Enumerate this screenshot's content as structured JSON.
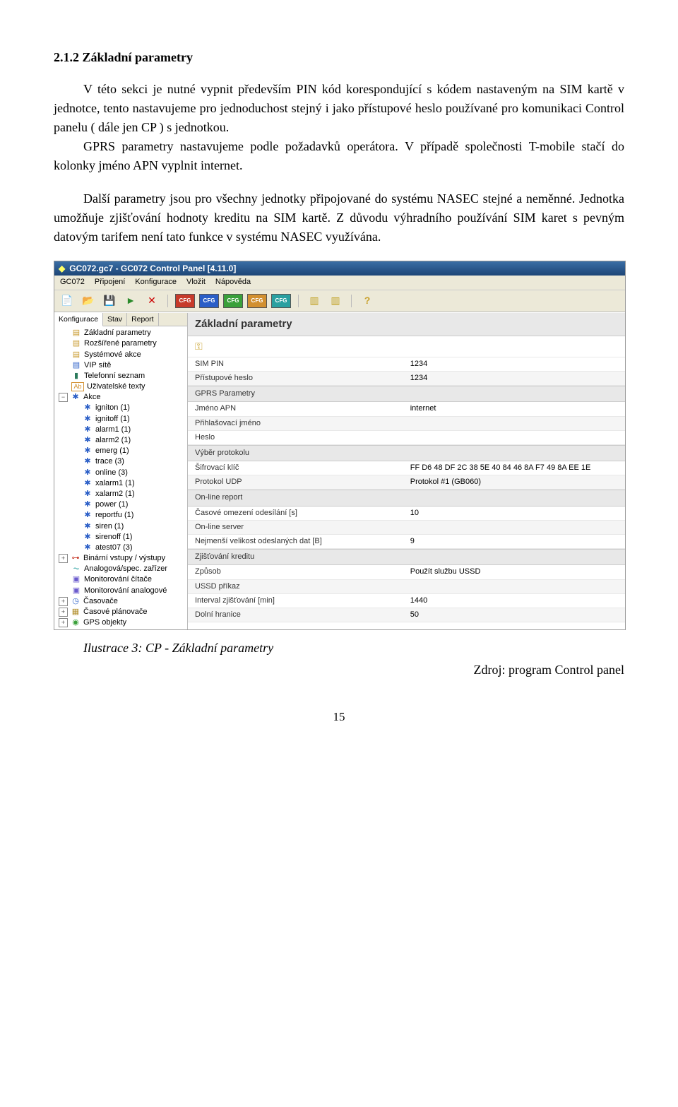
{
  "heading": "2.1.2  Základní parametry",
  "para1": "V této sekci je nutné vypnit především PIN kód korespondující s kódem nastaveným na SIM kartě v jednotce, tento nastavujeme pro jednoduchost stejný i jako přístupové heslo používané pro komunikaci Control panelu ( dále jen CP ) s jednotkou.",
  "para2": "GPRS parametry nastavujeme podle požadavků operátora. V případě společnosti T-mobile stačí do kolonky jméno APN vyplnit internet.",
  "para3": "Další parametry jsou pro všechny jednotky připojované do systému NASEC stejné a neměnné. Jednotka umožňuje zjišťování hodnoty kreditu na SIM kartě. Z důvodu výhradního používání SIM karet s pevným datovým tarifem není tato funkce v systému NASEC využívána.",
  "window": {
    "title": "GC072.gc7 - GC072 Control Panel [4.11.0]",
    "menu": [
      "GC072",
      "Připojení",
      "Konfigurace",
      "Vložit",
      "Nápověda"
    ],
    "cfg_labels": [
      "CFG",
      "CFG",
      "CFG",
      "CFG",
      "CFG"
    ],
    "side_tabs": [
      "Konfigurace",
      "Stav",
      "Report"
    ],
    "tree_top": [
      {
        "label": "Základní parametry"
      },
      {
        "label": "Rozšířené parametry"
      },
      {
        "label": "Systémové akce"
      },
      {
        "label": "VIP sítě"
      },
      {
        "label": "Telefonní seznam"
      },
      {
        "label": "Uživatelské texty"
      }
    ],
    "tree_akce_label": "Akce",
    "tree_akce": [
      "igniton (1)",
      "ignitoff (1)",
      "alarm1 (1)",
      "alarm2 (1)",
      "emerg (1)",
      "trace (3)",
      "online (3)",
      "xalarm1 (1)",
      "xalarm2 (1)",
      "power (1)",
      "reportfu (1)",
      "siren (1)",
      "sirenoff (1)",
      "atest07 (3)"
    ],
    "tree_bottom": [
      {
        "label": "Binární vstupy / výstupy"
      },
      {
        "label": "Analogová/spec. zařízer"
      },
      {
        "label": "Monitorování čítače"
      },
      {
        "label": "Monitorování analogové"
      },
      {
        "label": "Časovače"
      },
      {
        "label": "Časové plánovače"
      },
      {
        "label": "GPS objekty"
      }
    ],
    "panel_title": "Základní parametry",
    "rows": {
      "sim_pin_l": "SIM PIN",
      "sim_pin_v": "1234",
      "heslo_l": "Přístupové heslo",
      "heslo_v": "1234",
      "gprs_h": "GPRS Parametry",
      "apn_l": "Jméno APN",
      "apn_v": "internet",
      "login_l": "Přihlašovací jméno",
      "login_v": "",
      "hesloG_l": "Heslo",
      "hesloG_v": "",
      "proto_h": "Výběr protokolu",
      "sif_l": "Šifrovací klíč",
      "sif_v": "FF D6 48 DF 2C 38 5E 40 84 46 8A F7 49 8A EE 1E",
      "udp_l": "Protokol UDP",
      "udp_v": "Protokol #1 (GB060)",
      "online_h": "On-line report",
      "cas_l": "Časové omezení odesílání [s]",
      "cas_v": "10",
      "srv_l": "On-line server",
      "srv_v": "",
      "min_l": "Nejmenší velikost odeslaných dat [B]",
      "min_v": "9",
      "kredit_h": "Zjišťování kreditu",
      "zp_l": "Způsob",
      "zp_v": "Použít službu USSD",
      "ussd_l": "USSD příkaz",
      "ussd_v": "",
      "int_l": "Interval zjišťování [min]",
      "int_v": "1440",
      "dh_l": "Dolní hranice",
      "dh_v": "50"
    }
  },
  "caption": "Ilustrace 3: CP - Základní parametry",
  "source": "Zdroj: program Control panel",
  "page": "15"
}
